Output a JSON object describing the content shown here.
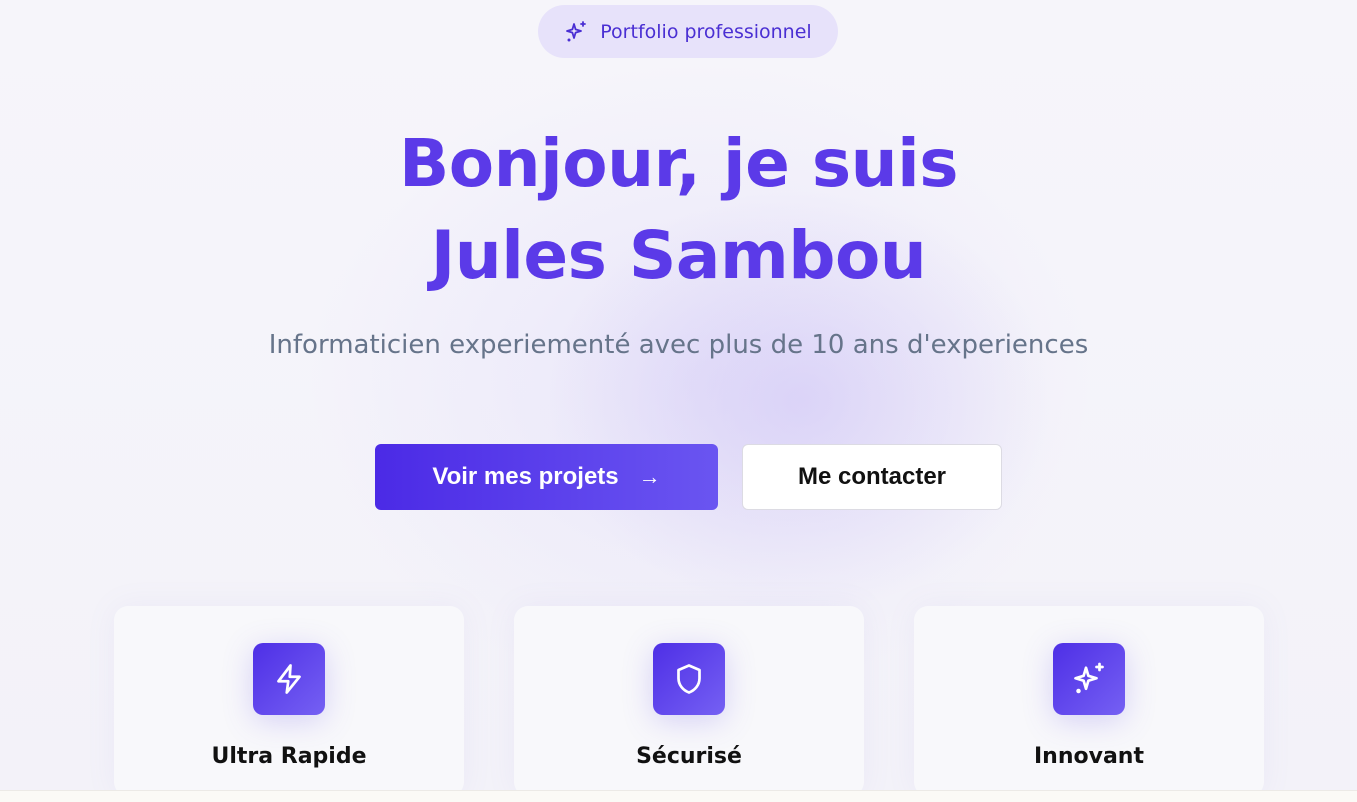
{
  "badge": {
    "label": "Portfolio professionnel",
    "icon": "sparkles-icon"
  },
  "hero": {
    "title_line1": "Bonjour, je suis",
    "title_line2": "Jules Sambou",
    "subtitle": "Informaticien experiementé avec plus de 10 ans d'experiences"
  },
  "actions": {
    "primary_label": "Voir mes projets",
    "primary_icon": "arrow-right-icon",
    "secondary_label": "Me contacter"
  },
  "features": [
    {
      "title": "Ultra Rapide",
      "icon": "lightning-icon"
    },
    {
      "title": "Sécurisé",
      "icon": "shield-icon"
    },
    {
      "title": "Innovant",
      "icon": "sparkles-icon"
    }
  ],
  "colors": {
    "accent": "#5b3ae8",
    "accent_dark": "#4b2ae6",
    "subtitle_text": "#66748a",
    "badge_bg": "#e7e2fa"
  }
}
